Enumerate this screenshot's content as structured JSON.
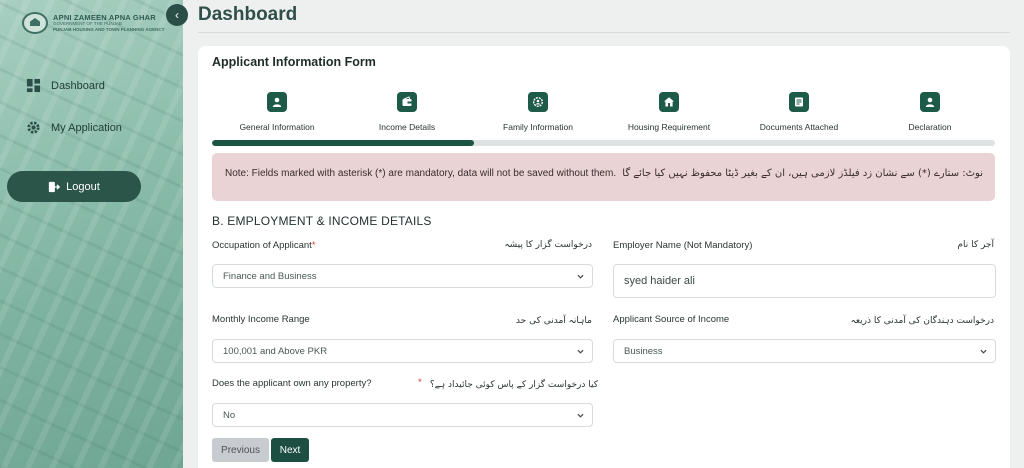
{
  "brand": {
    "title": "APNI ZAMEEN APNA GHAR",
    "subtitle": "GOVERNMENT OF THE PUNJAB",
    "agency": "PUNJAB HOUSING AND TOWN PLANNING AGENCY"
  },
  "sidebar": {
    "items": [
      {
        "label": "Dashboard",
        "icon": "grid-icon"
      },
      {
        "label": "My Application",
        "icon": "gear-icon"
      }
    ],
    "logout_label": "Logout"
  },
  "header": {
    "title": "Dashboard"
  },
  "form": {
    "title": "Applicant Information Form",
    "steps": [
      {
        "label": "General Information",
        "icon": "user-icon"
      },
      {
        "label": "Income Details",
        "icon": "wallet-icon"
      },
      {
        "label": "Family Information",
        "icon": "family-icon"
      },
      {
        "label": "Housing Requirement",
        "icon": "home-icon"
      },
      {
        "label": "Documents Attached",
        "icon": "document-icon"
      },
      {
        "label": "Declaration",
        "icon": "user-icon"
      }
    ],
    "progress_fraction": 0.335,
    "note_en": "Note: Fields marked with asterisk (*) are mandatory, data will not be saved without them.",
    "note_ur": "نوٹ: ستارے (*) سے نشان زد فیلڈز لازمی ہیں، ان کے بغیر ڈیٹا محفوظ نہیں کیا جائے گا",
    "section_title": "B. EMPLOYMENT & INCOME DETAILS",
    "fields": {
      "occupation": {
        "label": "Occupation of Applicant",
        "required": "*",
        "label_ur": "درخواست گزار کا پیشہ",
        "value": "Finance and Business"
      },
      "employer": {
        "label": "Employer Name (Not Mandatory)",
        "label_ur": "آجر کا نام",
        "value": "syed haider ali"
      },
      "income_range": {
        "label": "Monthly Income Range",
        "label_ur": "ماہانہ آمدنی کی حد",
        "value": "100,001 and Above PKR"
      },
      "income_source": {
        "label": "Applicant Source of Income",
        "label_ur": "درخواست دہندگان کی آمدنی کا ذریعہ",
        "value": "Business"
      },
      "property": {
        "label": "Does the applicant own any property?",
        "required": "*",
        "label_ur": "کیا درخواست گزار کے پاس کوئی جائیداد ہے؟",
        "value": "No"
      }
    },
    "buttons": {
      "previous": "Previous",
      "next": "Next"
    }
  },
  "colors": {
    "primary": "#1c5444",
    "note_bg": "#ead3d5",
    "sidebar": "#8fbfae"
  }
}
